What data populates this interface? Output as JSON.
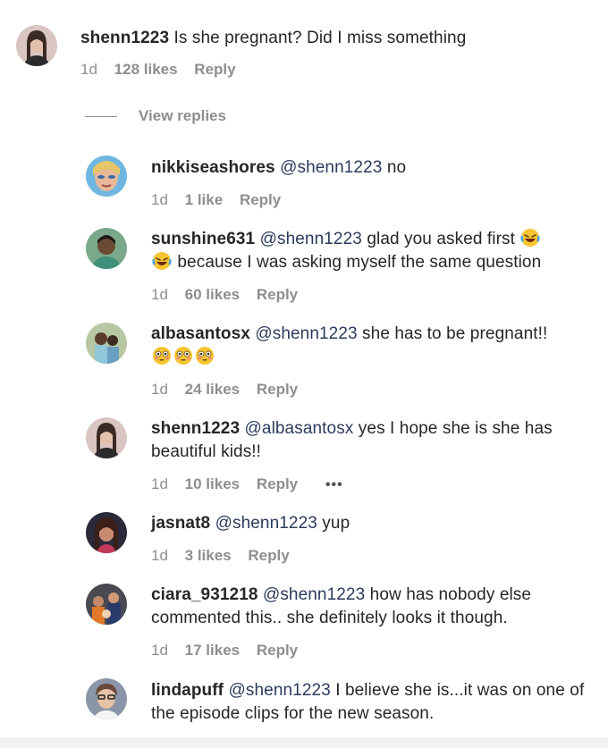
{
  "parent": {
    "username": "shenn1223",
    "text": "Is she pregnant? Did I miss something",
    "time": "1d",
    "likes": "128 likes",
    "reply": "Reply"
  },
  "view_replies_label": "View replies",
  "replies": [
    {
      "username": "nikkiseashores",
      "mention": "@shenn1223",
      "text": "no",
      "time": "1d",
      "likes": "1 like",
      "reply": "Reply"
    },
    {
      "username": "sunshine631",
      "mention": "@shenn1223",
      "text_before": "glad you asked first",
      "text_after": "because I was asking myself the same question",
      "emoji": "laughing-crying-emoji",
      "time": "1d",
      "likes": "60 likes",
      "reply": "Reply"
    },
    {
      "username": "albasantosx",
      "mention": "@shenn1223",
      "text": "she has to be pregnant!!",
      "emoji": "flushed-face-emoji",
      "time": "1d",
      "likes": "24 likes",
      "reply": "Reply"
    },
    {
      "username": "shenn1223",
      "mention": "@albasantosx",
      "text": "yes I hope she is she has beautiful kids!!",
      "time": "1d",
      "likes": "10 likes",
      "reply": "Reply",
      "more": "•••"
    },
    {
      "username": "jasnat8",
      "mention": "@shenn1223",
      "text": "yup",
      "time": "1d",
      "likes": "3 likes",
      "reply": "Reply"
    },
    {
      "username": "ciara_931218",
      "mention": "@shenn1223",
      "text": "how has nobody else commented this.. she definitely looks it though.",
      "time": "1d",
      "likes": "17 likes",
      "reply": "Reply"
    },
    {
      "username": "lindapuff",
      "mention": "@shenn1223",
      "text": "I believe she is...it was on one of the episode clips for the new season.",
      "time": "",
      "likes": "",
      "reply": ""
    }
  ],
  "colors": {
    "text": "#262626",
    "muted": "#8e8e8e",
    "mention": "#2b3b5c"
  }
}
